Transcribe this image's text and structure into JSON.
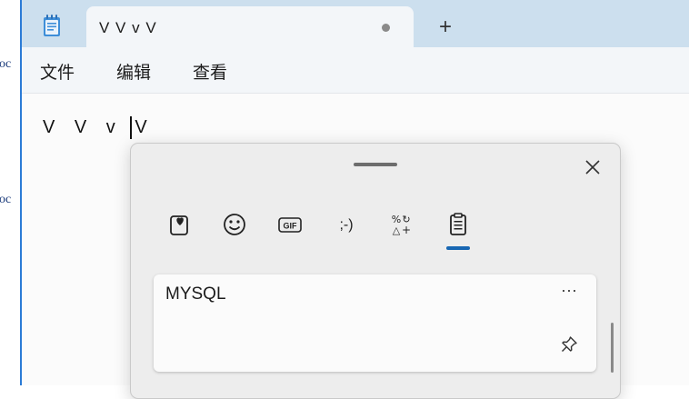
{
  "background": {
    "fragments": [
      "oc",
      "oc"
    ]
  },
  "window": {
    "tab_title": "V V v V",
    "new_tab_label": "+",
    "menu": [
      "文件",
      "编辑",
      "查看"
    ],
    "content": "V V v V"
  },
  "panel": {
    "categories": [
      {
        "name": "favorites",
        "icon": "heart-card-icon",
        "text": ""
      },
      {
        "name": "emoji",
        "icon": "smiley-icon",
        "text": ""
      },
      {
        "name": "gif",
        "icon": "gif-icon",
        "text": "GIF"
      },
      {
        "name": "kaomoji",
        "icon": "kaomoji-icon",
        "text": ";-)"
      },
      {
        "name": "symbols",
        "icon": "symbols-icon",
        "text": ""
      },
      {
        "name": "clipboard",
        "icon": "clipboard-icon",
        "text": "",
        "selected": true
      }
    ],
    "clipboard_items": [
      {
        "text": "MYSQL",
        "more_label": "···"
      }
    ]
  },
  "colors": {
    "titlebar": "#ccdfee",
    "accent": "#1867b3",
    "panel_bg": "#ededed"
  }
}
